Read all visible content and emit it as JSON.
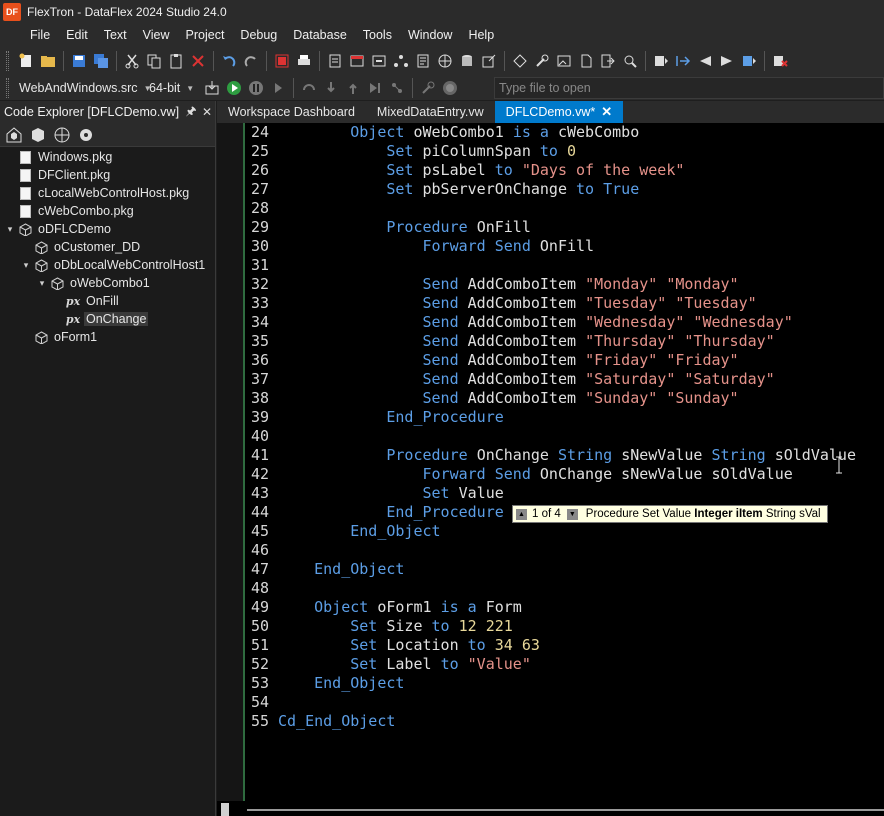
{
  "window": {
    "title": "FlexTron - DataFlex 2024 Studio 24.0",
    "logo_text": "DF"
  },
  "menu": [
    "File",
    "Edit",
    "Text",
    "View",
    "Project",
    "Debug",
    "Database",
    "Tools",
    "Window",
    "Help"
  ],
  "toolbar2": {
    "project_select": "WebAndWindows.src",
    "bitness_select": "64-bit",
    "file_search_placeholder": "Type file to open"
  },
  "code_explorer": {
    "title": "Code Explorer [DFLCDemo.vw]",
    "tree": [
      {
        "label": "Windows.pkg",
        "level": 0,
        "icon": "file-icon",
        "expander": ""
      },
      {
        "label": "DFClient.pkg",
        "level": 0,
        "icon": "file-icon",
        "expander": ""
      },
      {
        "label": "cLocalWebControlHost.pkg",
        "level": 0,
        "icon": "file-icon",
        "expander": ""
      },
      {
        "label": "cWebCombo.pkg",
        "level": 0,
        "icon": "file-icon",
        "expander": ""
      },
      {
        "label": "oDFLCDemo",
        "level": 0,
        "icon": "object-icon",
        "expander": "open"
      },
      {
        "label": "oCustomer_DD",
        "level": 1,
        "icon": "object-icon",
        "expander": ""
      },
      {
        "label": "oDbLocalWebControlHost1",
        "level": 1,
        "icon": "object-icon",
        "expander": "open"
      },
      {
        "label": "oWebCombo1",
        "level": 2,
        "icon": "object-icon",
        "expander": "open"
      },
      {
        "label": "OnFill",
        "level": 3,
        "icon": "procedure-icon",
        "expander": ""
      },
      {
        "label": "OnChange",
        "level": 3,
        "icon": "procedure-icon",
        "expander": "",
        "selected": true
      },
      {
        "label": "oForm1",
        "level": 1,
        "icon": "object-icon",
        "expander": ""
      }
    ]
  },
  "tabs": [
    {
      "label": "Workspace Dashboard",
      "active": false
    },
    {
      "label": "MixedDataEntry.vw",
      "active": false
    },
    {
      "label": "DFLCDemo.vw*",
      "active": true
    }
  ],
  "code": [
    {
      "n": "24",
      "indent": "        ",
      "parts": [
        [
          "kw",
          "Object "
        ],
        [
          "tx",
          "oWebCombo1 "
        ],
        [
          "kw",
          "is a "
        ],
        [
          "tx",
          "cWebCombo"
        ]
      ]
    },
    {
      "n": "25",
      "indent": "            ",
      "parts": [
        [
          "kw",
          "Set "
        ],
        [
          "tx",
          "piColumnSpan "
        ],
        [
          "kw",
          "to "
        ],
        [
          "num",
          "0"
        ]
      ]
    },
    {
      "n": "26",
      "indent": "            ",
      "parts": [
        [
          "kw",
          "Set "
        ],
        [
          "tx",
          "psLabel "
        ],
        [
          "kw",
          "to "
        ],
        [
          "str",
          "\"Days of the week\""
        ]
      ]
    },
    {
      "n": "27",
      "indent": "            ",
      "parts": [
        [
          "kw",
          "Set "
        ],
        [
          "tx",
          "pbServerOnChange "
        ],
        [
          "kw",
          "to True"
        ]
      ]
    },
    {
      "n": "28",
      "indent": "",
      "parts": []
    },
    {
      "n": "29",
      "indent": "            ",
      "parts": [
        [
          "kw",
          "Procedure "
        ],
        [
          "tx",
          "OnFill"
        ]
      ]
    },
    {
      "n": "30",
      "indent": "                ",
      "parts": [
        [
          "kw",
          "Forward Send "
        ],
        [
          "tx",
          "OnFill"
        ]
      ]
    },
    {
      "n": "31",
      "indent": "",
      "parts": []
    },
    {
      "n": "32",
      "indent": "                ",
      "parts": [
        [
          "kw",
          "Send "
        ],
        [
          "tx",
          "AddComboItem "
        ],
        [
          "str",
          "\"Monday\" \"Monday\""
        ]
      ]
    },
    {
      "n": "33",
      "indent": "                ",
      "parts": [
        [
          "kw",
          "Send "
        ],
        [
          "tx",
          "AddComboItem "
        ],
        [
          "str",
          "\"Tuesday\" \"Tuesday\""
        ]
      ]
    },
    {
      "n": "34",
      "indent": "                ",
      "parts": [
        [
          "kw",
          "Send "
        ],
        [
          "tx",
          "AddComboItem "
        ],
        [
          "str",
          "\"Wednesday\" \"Wednesday\""
        ]
      ]
    },
    {
      "n": "35",
      "indent": "                ",
      "parts": [
        [
          "kw",
          "Send "
        ],
        [
          "tx",
          "AddComboItem "
        ],
        [
          "str",
          "\"Thursday\" \"Thursday\""
        ]
      ]
    },
    {
      "n": "36",
      "indent": "                ",
      "parts": [
        [
          "kw",
          "Send "
        ],
        [
          "tx",
          "AddComboItem "
        ],
        [
          "str",
          "\"Friday\" \"Friday\""
        ]
      ]
    },
    {
      "n": "37",
      "indent": "                ",
      "parts": [
        [
          "kw",
          "Send "
        ],
        [
          "tx",
          "AddComboItem "
        ],
        [
          "str",
          "\"Saturday\" \"Saturday\""
        ]
      ]
    },
    {
      "n": "38",
      "indent": "                ",
      "parts": [
        [
          "kw",
          "Send "
        ],
        [
          "tx",
          "AddComboItem "
        ],
        [
          "str",
          "\"Sunday\" \"Sunday\""
        ]
      ]
    },
    {
      "n": "39",
      "indent": "            ",
      "parts": [
        [
          "kw",
          "End_Procedure"
        ]
      ]
    },
    {
      "n": "40",
      "indent": "",
      "parts": []
    },
    {
      "n": "41",
      "indent": "            ",
      "parts": [
        [
          "kw",
          "Procedure "
        ],
        [
          "tx",
          "OnChange "
        ],
        [
          "kw",
          "String "
        ],
        [
          "tx",
          "sNewValue "
        ],
        [
          "kw",
          "String "
        ],
        [
          "tx",
          "sOldValue"
        ]
      ]
    },
    {
      "n": "42",
      "indent": "                ",
      "parts": [
        [
          "kw",
          "Forward Send "
        ],
        [
          "tx",
          "OnChange sNewValue sOldValue"
        ]
      ]
    },
    {
      "n": "43",
      "indent": "                ",
      "parts": [
        [
          "kw",
          "Set "
        ],
        [
          "tx",
          "Value"
        ]
      ]
    },
    {
      "n": "44",
      "indent": "            ",
      "parts": [
        [
          "kw",
          "End_Procedure"
        ]
      ]
    },
    {
      "n": "45",
      "indent": "        ",
      "parts": [
        [
          "kw",
          "End_Object"
        ]
      ]
    },
    {
      "n": "46",
      "indent": "",
      "parts": []
    },
    {
      "n": "47",
      "indent": "    ",
      "parts": [
        [
          "kw",
          "End_Object"
        ]
      ]
    },
    {
      "n": "48",
      "indent": "",
      "parts": []
    },
    {
      "n": "49",
      "indent": "    ",
      "parts": [
        [
          "kw",
          "Object "
        ],
        [
          "tx",
          "oForm1 "
        ],
        [
          "kw",
          "is a "
        ],
        [
          "tx",
          "Form"
        ]
      ]
    },
    {
      "n": "50",
      "indent": "        ",
      "parts": [
        [
          "kw",
          "Set "
        ],
        [
          "tx",
          "Size "
        ],
        [
          "kw",
          "to "
        ],
        [
          "num",
          "12 221"
        ]
      ]
    },
    {
      "n": "51",
      "indent": "        ",
      "parts": [
        [
          "kw",
          "Set "
        ],
        [
          "tx",
          "Location "
        ],
        [
          "kw",
          "to "
        ],
        [
          "num",
          "34 63"
        ]
      ]
    },
    {
      "n": "52",
      "indent": "        ",
      "parts": [
        [
          "kw",
          "Set "
        ],
        [
          "tx",
          "Label "
        ],
        [
          "kw",
          "to "
        ],
        [
          "str",
          "\"Value\""
        ]
      ]
    },
    {
      "n": "53",
      "indent": "    ",
      "parts": [
        [
          "kw",
          "End_Object"
        ]
      ]
    },
    {
      "n": "54",
      "indent": "",
      "parts": []
    },
    {
      "n": "55",
      "indent": "",
      "parts": [
        [
          "kw",
          "Cd_End_Object"
        ]
      ]
    }
  ],
  "tooltip": {
    "counter": "1 of 4",
    "prefix": "Procedure Set Value ",
    "current_param": "Integer iItem",
    "suffix": " String sVal"
  },
  "colors": {
    "keyword": "#5c9ee6",
    "string": "#e5928a",
    "number": "#e8d89a",
    "active_tab": "#007acc"
  }
}
